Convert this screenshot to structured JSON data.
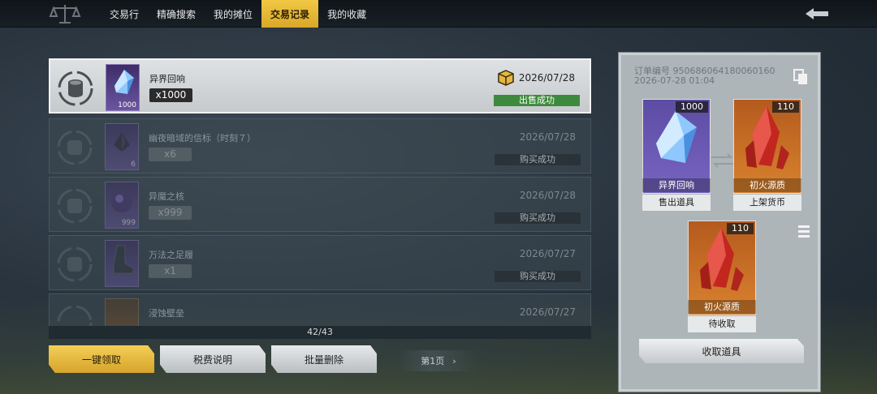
{
  "tabs": [
    "交易行",
    "精确搜索",
    "我的摊位",
    "交易记录",
    "我的收藏"
  ],
  "active_tab": 3,
  "records": [
    {
      "name": "异界回响",
      "count": "x1000",
      "thumb_qty": "1000",
      "date": "2026/07/28",
      "result": "出售成功",
      "active": true,
      "thumb_color": "#6a55a0"
    },
    {
      "name": "幽夜暗域的信标（时刻７）",
      "count": "x6",
      "thumb_qty": "6",
      "date": "2026/07/28",
      "result": "购买成功",
      "active": false,
      "thumb_color": "#5b4a8a"
    },
    {
      "name": "异魔之核",
      "count": "x999",
      "thumb_qty": "999",
      "date": "2026/07/28",
      "result": "购买成功",
      "active": false,
      "thumb_color": "#5b4a8a"
    },
    {
      "name": "万法之足履",
      "count": "x1",
      "thumb_qty": "",
      "date": "2026/07/27",
      "result": "购买成功",
      "active": false,
      "thumb_color": "#5b4a8a"
    },
    {
      "name": "浸蚀壁垒",
      "count": "",
      "thumb_qty": "",
      "date": "2026/07/27",
      "result": "",
      "active": false,
      "thumb_color": "#8a5a2a"
    }
  ],
  "pagination": {
    "count": "42/43",
    "page_label": "第1页"
  },
  "buttons": {
    "collect_all": "一键领取",
    "tax_info": "税费说明",
    "batch_delete": "批量删除"
  },
  "detail": {
    "order_no": "订单编号 950686064180060160",
    "order_time": "2026-07-28 01:04",
    "sold": {
      "name": "异界回响",
      "num": "1000",
      "role": "售出道具"
    },
    "listed": {
      "name": "初火源质",
      "num": "110",
      "role": "上架货币"
    },
    "pending": {
      "name": "初火源质",
      "num": "110",
      "role": "待收取"
    },
    "collect_btn": "收取道具"
  },
  "icons": {
    "logo": "scales-icon",
    "back": "back-arrow-icon",
    "status": "coins-exchange-icon",
    "box": "package-box-icon",
    "copy": "copy-icon",
    "menu": "menu-icon"
  },
  "colors": {
    "accent": "#e2b538",
    "success": "#3e8a3c",
    "purple": "#6a55a0",
    "orange": "#d9822e"
  }
}
